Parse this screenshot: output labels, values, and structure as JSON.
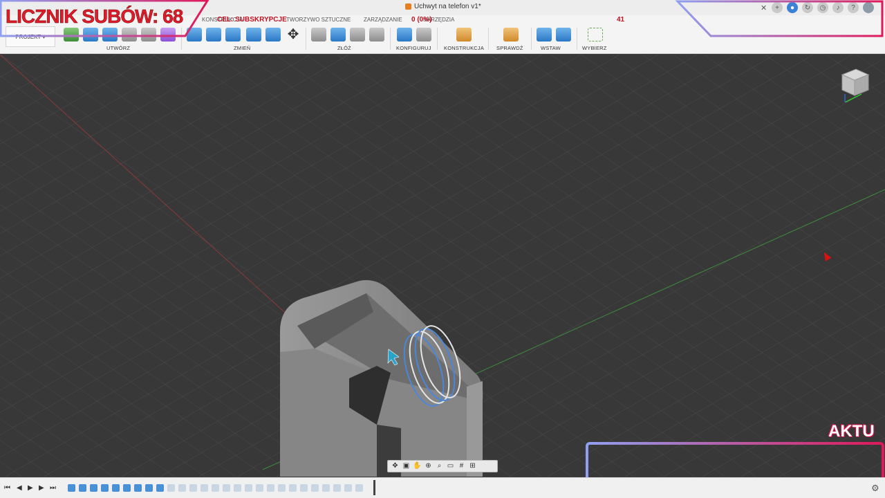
{
  "window": {
    "title": "Uchwyt na telefon v1*"
  },
  "tabs": [
    "KONSTRUKCJA",
    "TWORZYWO SZTUCZNE",
    "ZARZĄDZANIE",
    "NARZĘDZIA"
  ],
  "project_label": "PROJEKT",
  "toolbar_groups": {
    "create": "UTWÓRZ",
    "modify": "ZMIEŃ",
    "assemble": "ZŁÓŻ",
    "configure": "KONFIGURUJ",
    "construct": "KONSTRUKCJA",
    "inspect": "SPRAWDŹ",
    "insert": "WSTAW",
    "select": "WYBIERZ"
  },
  "overlay": {
    "sub_counter": "LICZNIK SUBÓW: 68",
    "goal_label": "CEL: SUBSKRYPCJE",
    "goal_progress": "0 (0%)",
    "goal_number": "41",
    "aktu": "AKTU"
  },
  "icons": {
    "close": "close-icon",
    "add_tab": "plus-icon",
    "help": "help-icon",
    "notifications": "bell-icon",
    "settings": "gear-icon"
  },
  "colors": {
    "overlay_red": "#e01b2a",
    "accent_blue": "#2a78c6",
    "viewport_bg": "#3a3a3a"
  }
}
